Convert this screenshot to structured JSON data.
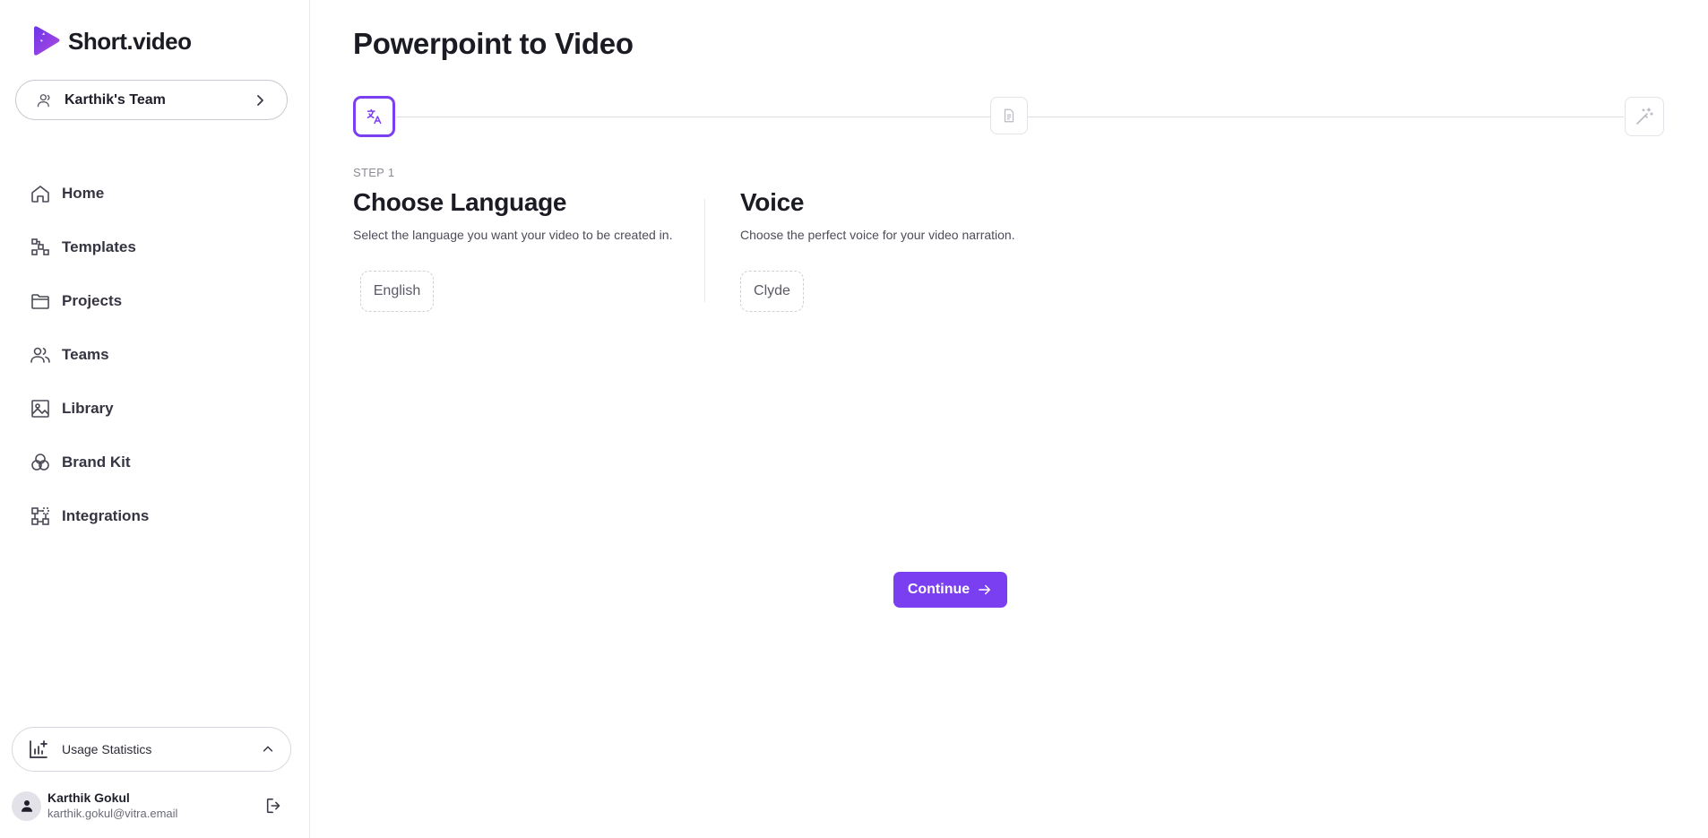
{
  "brand": {
    "name": "Short.video",
    "accent": "#7b3ff2"
  },
  "team": {
    "label": "Karthik's Team"
  },
  "nav": [
    {
      "label": "Home",
      "icon": "home-icon"
    },
    {
      "label": "Templates",
      "icon": "templates-icon"
    },
    {
      "label": "Projects",
      "icon": "folder-icon"
    },
    {
      "label": "Teams",
      "icon": "users-icon"
    },
    {
      "label": "Library",
      "icon": "image-icon"
    },
    {
      "label": "Brand Kit",
      "icon": "palette-icon"
    },
    {
      "label": "Integrations",
      "icon": "integrations-icon"
    }
  ],
  "usage": {
    "label": "Usage Statistics"
  },
  "user": {
    "name": "Karthik Gokul",
    "email": "karthik.gokul@vitra.email"
  },
  "page": {
    "title": "Powerpoint to Video"
  },
  "stepper": {
    "step_label": "STEP 1",
    "steps": [
      {
        "icon": "translate-icon",
        "active": true
      },
      {
        "icon": "document-icon",
        "active": false
      },
      {
        "icon": "magic-wand-icon",
        "active": false
      }
    ]
  },
  "language": {
    "title": "Choose Language",
    "description": "Select the language you want your video to be created in.",
    "selected": "English"
  },
  "voice": {
    "title": "Voice",
    "description": "Choose the perfect voice for your video narration.",
    "selected": "Clyde"
  },
  "actions": {
    "continue_label": "Continue"
  }
}
